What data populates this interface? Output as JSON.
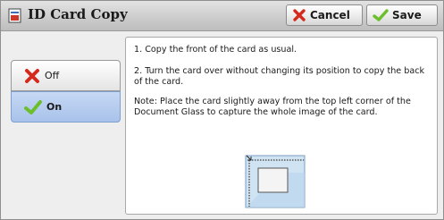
{
  "window": {
    "title": "ID Card Copy",
    "title_icon": "id-card-copy-icon"
  },
  "toolbar": {
    "cancel_label": "Cancel",
    "save_label": "Save",
    "cancel_icon": "red-x-icon",
    "save_icon": "green-check-icon"
  },
  "options": {
    "items": [
      {
        "label": "Off",
        "icon": "red-x-icon",
        "selected": false
      },
      {
        "label": "On",
        "icon": "green-check-icon",
        "selected": true
      }
    ]
  },
  "instructions": {
    "step1": "1. Copy the front of the card as usual.",
    "step2": "2. Turn the card over without changing its position to copy the back of the card.",
    "note": "Note: Place the card slightly away from the top left corner of the Document Glass to capture the whole image of the card.",
    "diagram_icon": "document-glass-card-placement-icon"
  },
  "colors": {
    "selected_option": "#a8c2ea",
    "cancel_x": "#d42a1e",
    "save_check": "#6cbf2a"
  }
}
